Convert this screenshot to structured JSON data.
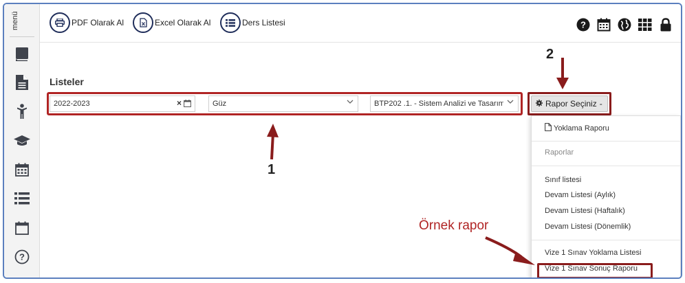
{
  "sidebar": {
    "menu_label": "menü",
    "icons": [
      "book-icon",
      "document-icon",
      "person-icon",
      "graduation-cap-icon",
      "calendar-icon",
      "list-icon",
      "calendar-empty-icon",
      "help-circle-icon"
    ]
  },
  "toolbar": {
    "pdf_label": "PDF Olarak Al",
    "excel_label": "Excel Olarak Al",
    "course_list_label": "Ders Listesi"
  },
  "header_icons": [
    "question-circle-icon",
    "calendar-icon",
    "globe-icon",
    "grid-icon",
    "lock-icon"
  ],
  "main": {
    "title": "Listeler",
    "filters": {
      "year_value": "2022-2023",
      "term_value": "Güz",
      "course_value": "BTP202 .1. - Sistem Analizi ve Tasarım"
    },
    "report_button_label": "Rapor Seçiniz",
    "dropdown": {
      "attendance_report": "Yoklama Raporu",
      "reports_header": "Raporlar",
      "items": [
        "Sınıf listesi",
        "Devam Listesi (Aylık)",
        "Devam Listesi (Haftalık)",
        "Devam Listesi (Dönemlik)"
      ],
      "exam_attendance": "Vize 1 Sınav Yoklama Listesi",
      "exam_result": "Vize 1 Sınav Sonuç Raporu"
    }
  },
  "annotations": {
    "step1": "1",
    "step2": "2",
    "example_label": "Örnek rapor"
  },
  "colors": {
    "accent_dark": "#1f2d5a",
    "highlight_red": "#b02424",
    "frame_blue": "#5b7fbe"
  }
}
